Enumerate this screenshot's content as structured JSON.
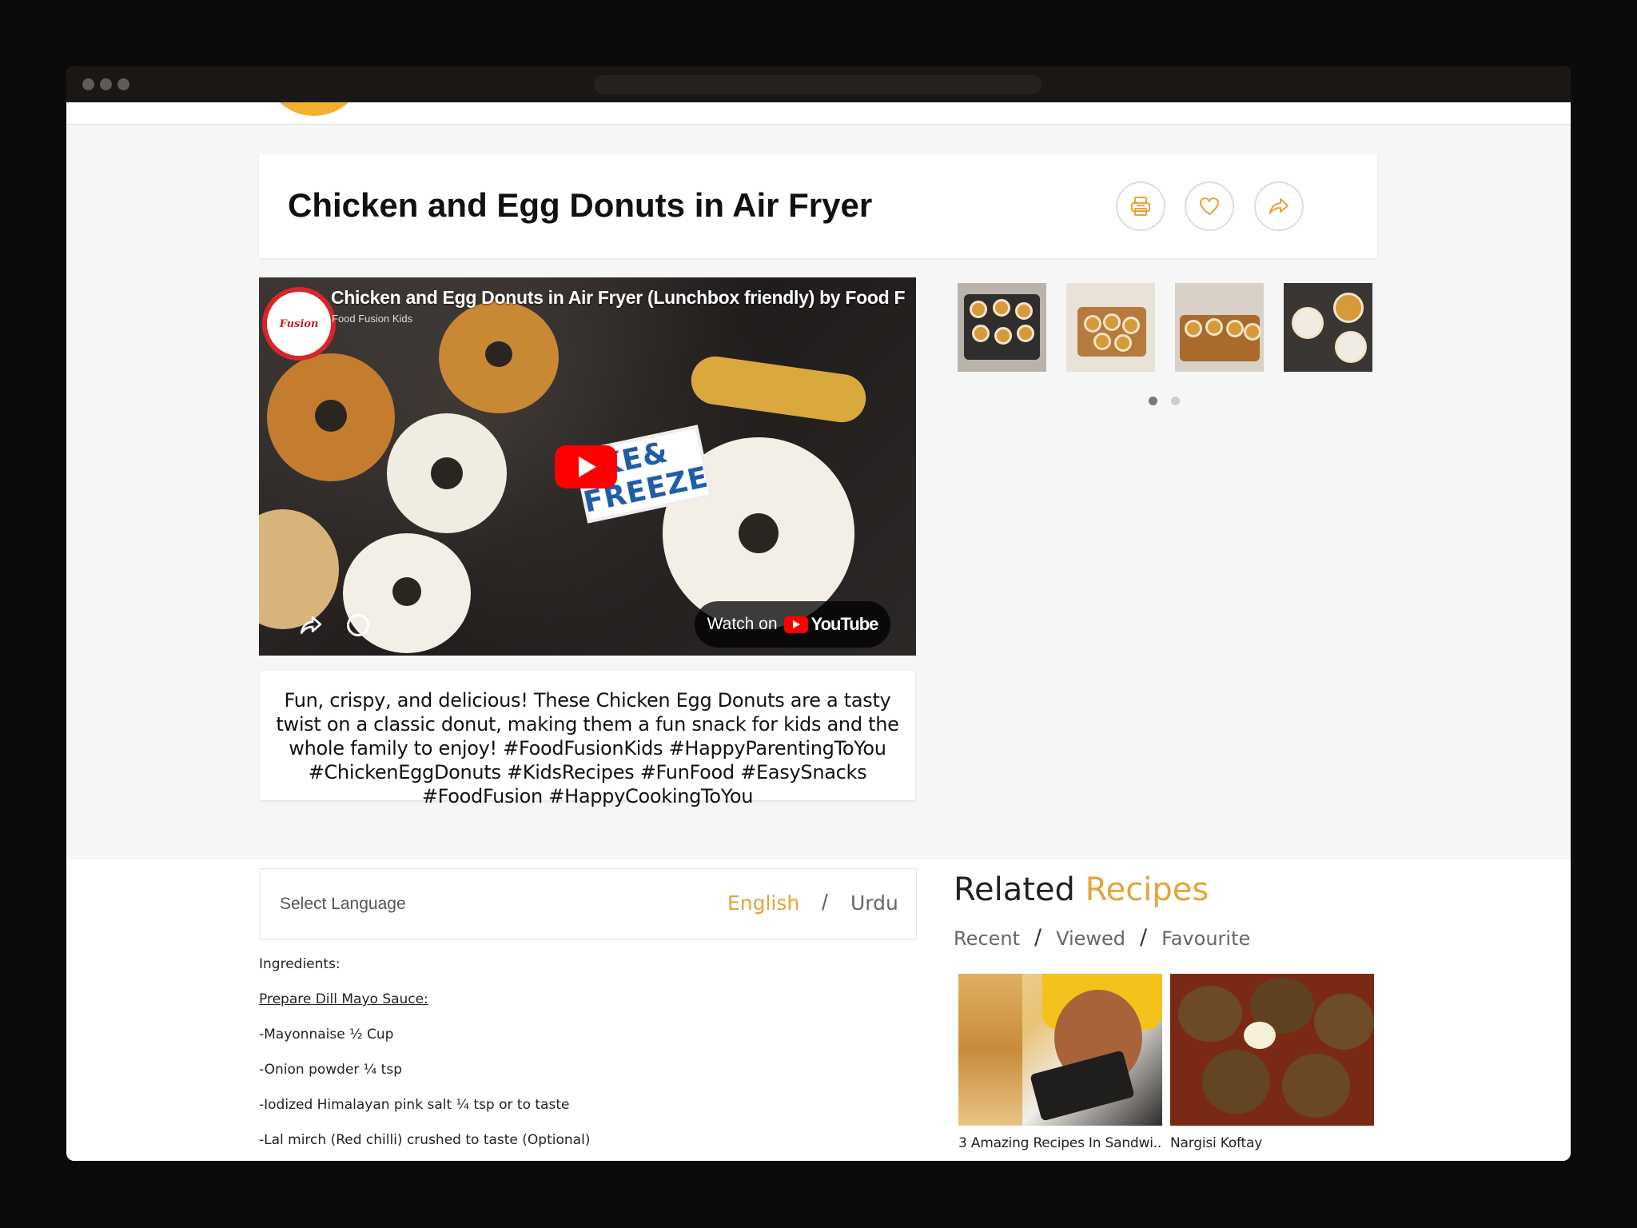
{
  "recipe": {
    "title": "Chicken and Egg Donuts in Air Fryer"
  },
  "actions": {
    "print_icon": "print-icon",
    "favourite_icon": "heart-icon",
    "share_icon": "share-icon"
  },
  "video": {
    "title": "Chicken and Egg Donuts in Air Fryer (Lunchbox friendly) by Food F",
    "channel": "Food Fusion Kids",
    "channel_logo_text": "Fusion",
    "sticker_text": "AKE& FREEZE",
    "watch_on": "Watch on",
    "youtube_word": "YouTube"
  },
  "gallery": {
    "thumbnail_count": 4,
    "pages": 2,
    "active_page": 1
  },
  "description": "Fun, crispy, and delicious! These Chicken Egg Donuts are a tasty twist on a classic donut, making them a fun snack for kids and the whole family to enjoy! #FoodFusionKids #HappyParentingToYou #ChickenEggDonuts #KidsRecipes #FunFood #EasySnacks #FoodFusion #HappyCookingToYou",
  "language": {
    "label": "Select Language",
    "english": "English",
    "separator": "/",
    "urdu": "Urdu"
  },
  "ingredients": {
    "heading": "Ingredients:",
    "section": "Prepare Dill Mayo Sauce:",
    "items": [
      "-Mayonnaise ½ Cup",
      "-Onion powder ¼ tsp",
      "-Iodized Himalayan pink salt ¼ tsp or to taste",
      "-Lal mirch (Red chilli) crushed to taste (Optional)"
    ]
  },
  "related": {
    "title_part1": "Related",
    "title_part2": "Recipes",
    "tabs": [
      "Recent",
      "Viewed",
      "Favourite"
    ],
    "separator": "/",
    "cards": [
      {
        "caption": "3 Amazing Recipes In Sandwi..."
      },
      {
        "caption": "Nargisi Koftay"
      }
    ]
  },
  "colors": {
    "accent": "#e4a43a",
    "youtube_red": "#ff0000",
    "logo_yellow": "#f4b02a"
  }
}
